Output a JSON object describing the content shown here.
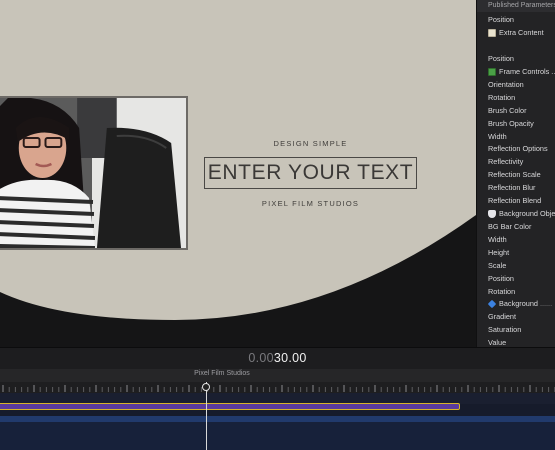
{
  "viewer": {
    "tagline_top": "DESIGN SIMPLE",
    "title": "ENTER YOUR TEXT",
    "tagline_bottom": "PIXEL FILM STUDIOS"
  },
  "inspector": {
    "header": "Published Parameters",
    "items": [
      {
        "label": "Position",
        "icon": null
      },
      {
        "label": "Extra Content",
        "icon": "document-icon"
      },
      {
        "label": "Position",
        "icon": null
      },
      {
        "label": "Frame Controls ...",
        "icon": "film-icon"
      },
      {
        "label": "Orientation",
        "icon": null
      },
      {
        "label": "Rotation",
        "icon": null
      },
      {
        "label": "Brush Color",
        "icon": null
      },
      {
        "label": "Brush Opacity",
        "icon": null
      },
      {
        "label": "Width",
        "icon": null
      },
      {
        "label": "Reflection Options",
        "icon": null
      },
      {
        "label": "Reflectivity",
        "icon": null
      },
      {
        "label": "Reflection Scale",
        "icon": null
      },
      {
        "label": "Reflection Blur",
        "icon": null
      },
      {
        "label": "Reflection Blend",
        "icon": null
      },
      {
        "label": "Background Obje",
        "icon": "shield-icon"
      },
      {
        "label": "BG Bar Color",
        "icon": null
      },
      {
        "label": "Width",
        "icon": null
      },
      {
        "label": "Height",
        "icon": null
      },
      {
        "label": "Scale",
        "icon": null
      },
      {
        "label": "Position",
        "icon": null
      },
      {
        "label": "Rotation",
        "icon": null
      },
      {
        "label": "Background",
        "icon": "diamond-icon",
        "suffix": "......"
      },
      {
        "label": "Gradient",
        "icon": null
      },
      {
        "label": "Saturation",
        "icon": null
      },
      {
        "label": "Value",
        "icon": null
      }
    ]
  },
  "timecode": {
    "dim": "0.00",
    "bright": "30.00"
  },
  "project": {
    "name": "Pixel Film Studios"
  },
  "colors": {
    "stage": "#c8c4b9",
    "accent_clip": "#5a3b9e",
    "clip_border": "#d7b528",
    "track_blue": "#213a6c"
  }
}
